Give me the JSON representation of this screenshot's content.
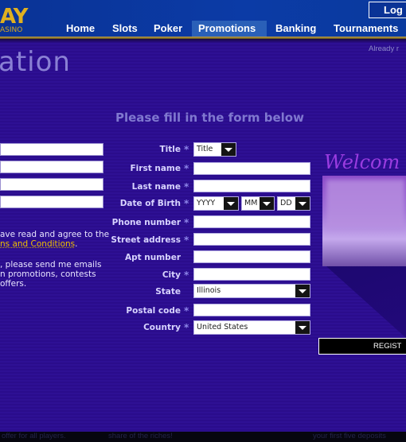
{
  "header": {
    "logo_text": "AY",
    "logo_sub": "ASINO",
    "login_label": "Log",
    "nav": [
      {
        "label": "Home"
      },
      {
        "label": "Slots"
      },
      {
        "label": "Poker"
      },
      {
        "label": "Promotions",
        "active": true
      },
      {
        "label": "Banking"
      },
      {
        "label": "Tournaments"
      }
    ]
  },
  "page": {
    "title_fragment": "ation",
    "already_text": "Already r",
    "heading": "Please fill in the form below"
  },
  "left": {
    "agree_line1": "ave read and agree to the",
    "agree_link": "ns and Conditions",
    "agree_period": ".",
    "email_line1": ", please send me emails",
    "email_line2": "n promotions, contests",
    "email_line3": " offers."
  },
  "form": {
    "title": {
      "label": "Title",
      "required": "*",
      "value": "Title"
    },
    "first_name": {
      "label": "First name",
      "required": "*",
      "value": ""
    },
    "last_name": {
      "label": "Last name",
      "required": "*",
      "value": ""
    },
    "dob": {
      "label": "Date of Birth",
      "required": "*",
      "year": "YYYY",
      "month": "MM",
      "day": "DD"
    },
    "phone": {
      "label": "Phone number",
      "required": "*",
      "value": ""
    },
    "street": {
      "label": "Street address",
      "required": "*",
      "value": ""
    },
    "apt": {
      "label": "Apt number",
      "value": ""
    },
    "city": {
      "label": "City",
      "required": "*",
      "value": ""
    },
    "state": {
      "label": "State",
      "value": "Illinois"
    },
    "postal": {
      "label": "Postal code",
      "required": "*",
      "value": ""
    },
    "country": {
      "label": "Country",
      "required": "*",
      "value": "United States"
    }
  },
  "promo": {
    "welcome_text": "Welcom"
  },
  "register_label": "REGIST",
  "footer": {
    "t1": "offer for all players.",
    "t2": "share of the riches!",
    "t3": "your first five deposits"
  }
}
